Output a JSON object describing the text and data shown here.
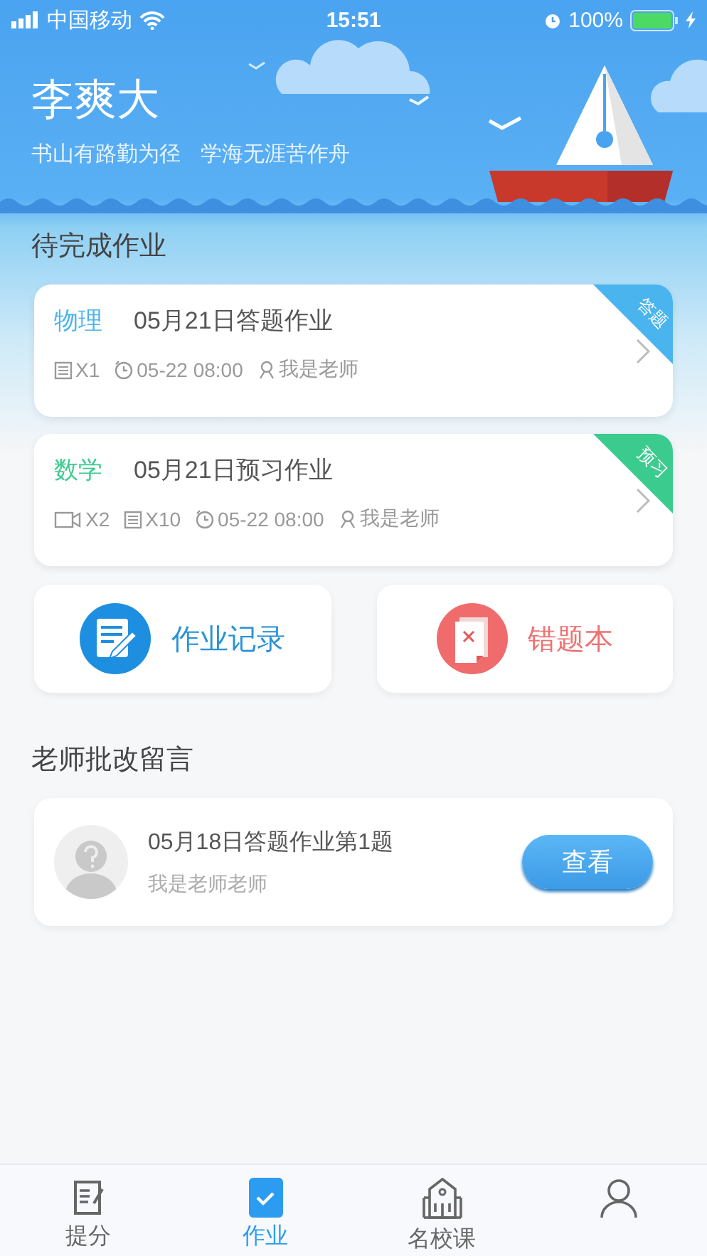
{
  "status_bar": {
    "carrier": "中国移动",
    "time": "15:51",
    "battery": "100%"
  },
  "header": {
    "name": "李爽大",
    "motto": [
      "书山有路勤为径",
      "学海无涯苦作舟"
    ]
  },
  "pending": {
    "title": "待完成作业",
    "assignments": [
      {
        "subject": "物理",
        "title": "05月21日答题作业",
        "tag": "答题",
        "color": "#4ab4ee",
        "meta": [
          {
            "kind": "document",
            "text": "X1"
          },
          {
            "kind": "clock",
            "text": "05-22 08:00"
          },
          {
            "kind": "teacher",
            "text": "我是老师"
          }
        ]
      },
      {
        "subject": "数学",
        "title": "05月21日预习作业",
        "tag": "预习",
        "color": "#3ccb8f",
        "meta": [
          {
            "kind": "video",
            "text": "X2"
          },
          {
            "kind": "document",
            "text": "X10"
          },
          {
            "kind": "clock",
            "text": "05-22 08:00"
          },
          {
            "kind": "teacher",
            "text": "我是老师"
          }
        ]
      }
    ]
  },
  "shortcuts": [
    {
      "kind": "record",
      "label": "作业记录"
    },
    {
      "kind": "mistakes",
      "label": "错题本"
    }
  ],
  "comments": {
    "title": "老师批改留言",
    "items": [
      {
        "title": "05月18日答题作业第1题",
        "author": "我是老师老师",
        "button": "查看"
      }
    ]
  },
  "tabs": [
    {
      "kind": "score",
      "label": "提分",
      "selected": false
    },
    {
      "kind": "homework",
      "label": "作业",
      "selected": true
    },
    {
      "kind": "school",
      "label": "名校课",
      "selected": false
    },
    {
      "kind": "me",
      "selected": false
    }
  ]
}
